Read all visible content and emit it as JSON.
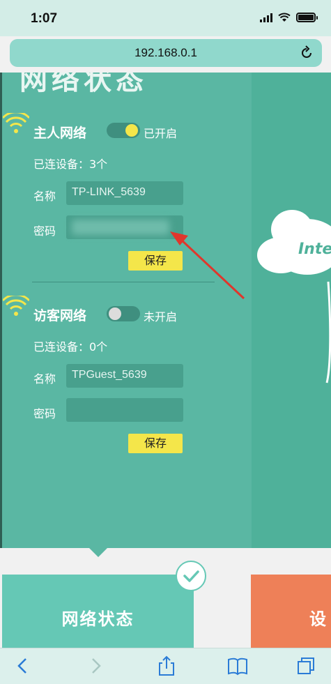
{
  "status_bar": {
    "time": "1:07"
  },
  "browser": {
    "url": "192.168.0.1"
  },
  "page": {
    "title": "网络状态"
  },
  "main_network": {
    "title": "主人网络",
    "toggle_state": "已开启",
    "devices": "已连设备：3个",
    "name_label": "名称",
    "name_value": "TP-LINK_5639",
    "password_label": "密码",
    "save": "保存"
  },
  "guest_network": {
    "title": "访客网络",
    "toggle_state": "未开启",
    "devices": "已连设备：0个",
    "name_label": "名称",
    "name_value": "TPGuest_5639",
    "password_label": "密码",
    "password_value": "",
    "save": "保存"
  },
  "right_panel": {
    "cloud_label": "Inte"
  },
  "tiles": {
    "network_status": "网络状态",
    "settings": "设"
  },
  "colors": {
    "panel": "#5ab7a3",
    "accent_yellow": "#f4e64a",
    "tile_green": "#65c8b5",
    "tile_orange": "#ee8058"
  }
}
